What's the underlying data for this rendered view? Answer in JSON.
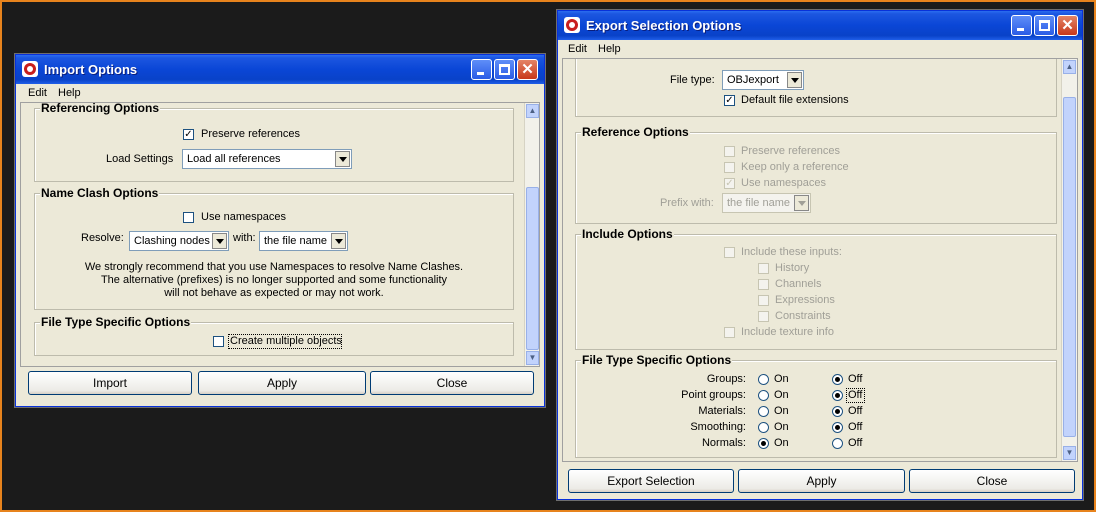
{
  "import_window": {
    "title": "Import Options",
    "menu": [
      "Edit",
      "Help"
    ],
    "referencing": {
      "title": "Referencing Options",
      "preserve_references": {
        "label": "Preserve references",
        "checked": true
      },
      "load_settings_label": "Load Settings",
      "load_settings_value": "Load all references"
    },
    "name_clash": {
      "title": "Name Clash Options",
      "use_namespaces": {
        "label": "Use namespaces",
        "checked": false
      },
      "resolve_label": "Resolve:",
      "resolve_value": "Clashing nodes",
      "with_label": "with:",
      "with_value": "the file name",
      "note_line1": "We strongly recommend that you use Namespaces to resolve Name Clashes.",
      "note_line2": "The alternative (prefixes) is no longer supported and some functionality",
      "note_line3": "will not behave as expected or may not work."
    },
    "file_type": {
      "title": "File Type Specific Options",
      "create_multiple_objects": {
        "label": "Create multiple objects",
        "checked": false
      }
    },
    "buttons": {
      "import": "Import",
      "apply": "Apply",
      "close": "Close"
    }
  },
  "export_window": {
    "title": "Export Selection Options",
    "menu": [
      "Edit",
      "Help"
    ],
    "file_type_label": "File type:",
    "file_type_value": "OBJexport",
    "default_file_extensions": {
      "label": "Default file extensions",
      "checked": true
    },
    "reference": {
      "title": "Reference Options",
      "preserve_references": "Preserve references",
      "keep_only_reference": "Keep only a reference",
      "use_namespaces": "Use namespaces",
      "prefix_label": "Prefix with:",
      "prefix_value": "the file name"
    },
    "include": {
      "title": "Include Options",
      "include_inputs": "Include these inputs:",
      "history": "History",
      "channels": "Channels",
      "expressions": "Expressions",
      "constraints": "Constraints",
      "include_texture": "Include texture info"
    },
    "file_specific": {
      "title": "File Type Specific Options",
      "on_label": "On",
      "off_label": "Off",
      "rows": [
        {
          "label": "Groups:",
          "value": "Off"
        },
        {
          "label": "Point groups:",
          "value": "Off"
        },
        {
          "label": "Materials:",
          "value": "Off"
        },
        {
          "label": "Smoothing:",
          "value": "Off"
        },
        {
          "label": "Normals:",
          "value": "On"
        }
      ]
    },
    "buttons": {
      "export_selection": "Export Selection",
      "apply": "Apply",
      "close": "Close"
    }
  }
}
